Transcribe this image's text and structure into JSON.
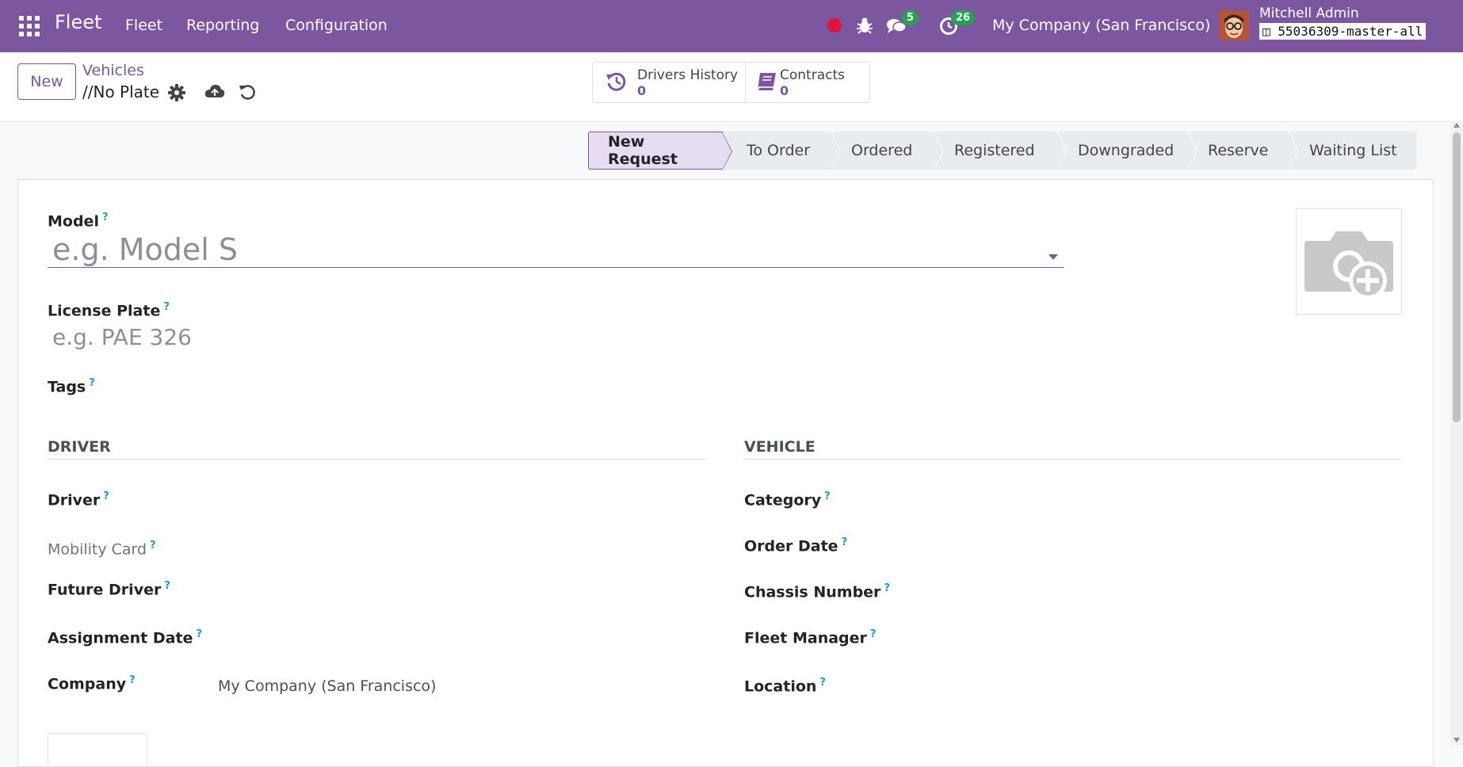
{
  "navbar": {
    "brand": "Fleet",
    "menu": [
      "Fleet",
      "Reporting",
      "Configuration"
    ],
    "messages_count": "5",
    "activities_count": "26",
    "company": "My Company (San Francisco)",
    "user_name": "Mitchell Admin",
    "db_name": "55036309-master-all",
    "recording_color": "#e0143c"
  },
  "control": {
    "new_label": "New",
    "breadcrumb": "Vehicles",
    "record_name": "//No Plate",
    "smart_buttons": [
      {
        "label": "Drivers History",
        "count": "0",
        "icon": "history-icon"
      },
      {
        "label": "Contracts",
        "count": "0",
        "icon": "book-icon"
      }
    ]
  },
  "statusbar": {
    "stages": [
      "New Request",
      "To Order",
      "Ordered",
      "Registered",
      "Downgraded",
      "Reserve",
      "Waiting List"
    ],
    "active": "New Request"
  },
  "form": {
    "model_label": "Model",
    "model_placeholder": "e.g. Model S",
    "plate_label": "License Plate",
    "plate_placeholder": "e.g. PAE 326",
    "tags_label": "Tags",
    "help_mark": "?",
    "driver_section": "DRIVER",
    "vehicle_section": "VEHICLE",
    "driver_fields": [
      "Driver",
      "Mobility Card",
      "Future Driver",
      "Assignment Date",
      "Company"
    ],
    "company_value": "My Company (San Francisco)",
    "vehicle_fields": [
      "Category",
      "Order Date",
      "Chassis Number",
      "Fleet Manager",
      "Location"
    ]
  },
  "colors": {
    "brand": "#7c569f",
    "badge": "#22a350",
    "help": "#1a9bd7"
  }
}
